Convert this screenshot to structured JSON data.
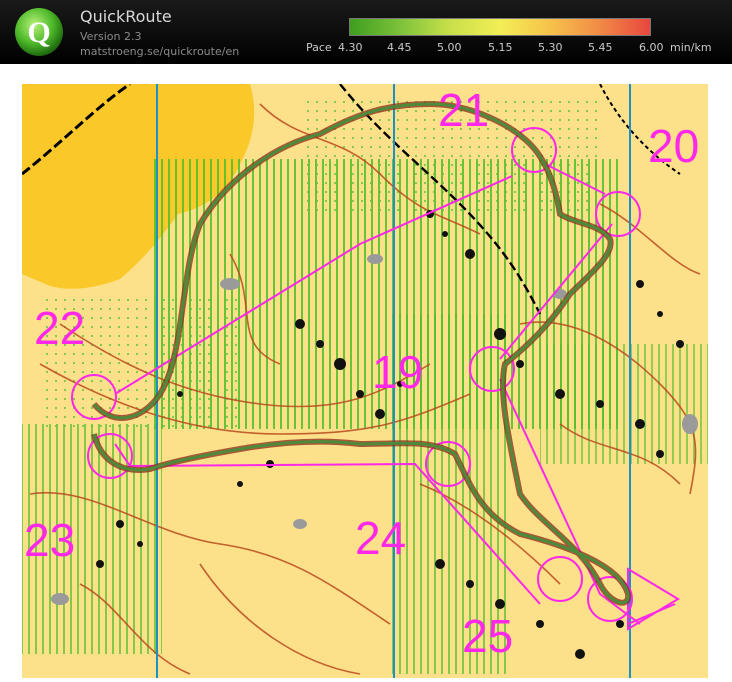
{
  "app": {
    "name": "QuickRoute",
    "version": "Version 2.3",
    "url": "matstroeng.se/quickroute/en",
    "logo_letter": "Q"
  },
  "pace_legend": {
    "label": "Pace",
    "ticks": [
      "4.30",
      "4.45",
      "5.00",
      "5.15",
      "5.30",
      "5.45",
      "6.00"
    ],
    "unit": "min/km",
    "colors": [
      "#3f9e1f",
      "#7cc23a",
      "#c8e04a",
      "#f2ee55",
      "#f7c24b",
      "#f18a46",
      "#e8463e"
    ]
  },
  "map": {
    "north_line_color": "#1e90c8",
    "course_color": "#ff28e8",
    "route_color": "#3e6f35",
    "map_background": "#fde08a",
    "open_land_color": "#fbc82a",
    "controls": [
      {
        "number": "19"
      },
      {
        "number": "20"
      },
      {
        "number": "21"
      },
      {
        "number": "22"
      },
      {
        "number": "23"
      },
      {
        "number": "24"
      },
      {
        "number": "25"
      }
    ]
  }
}
